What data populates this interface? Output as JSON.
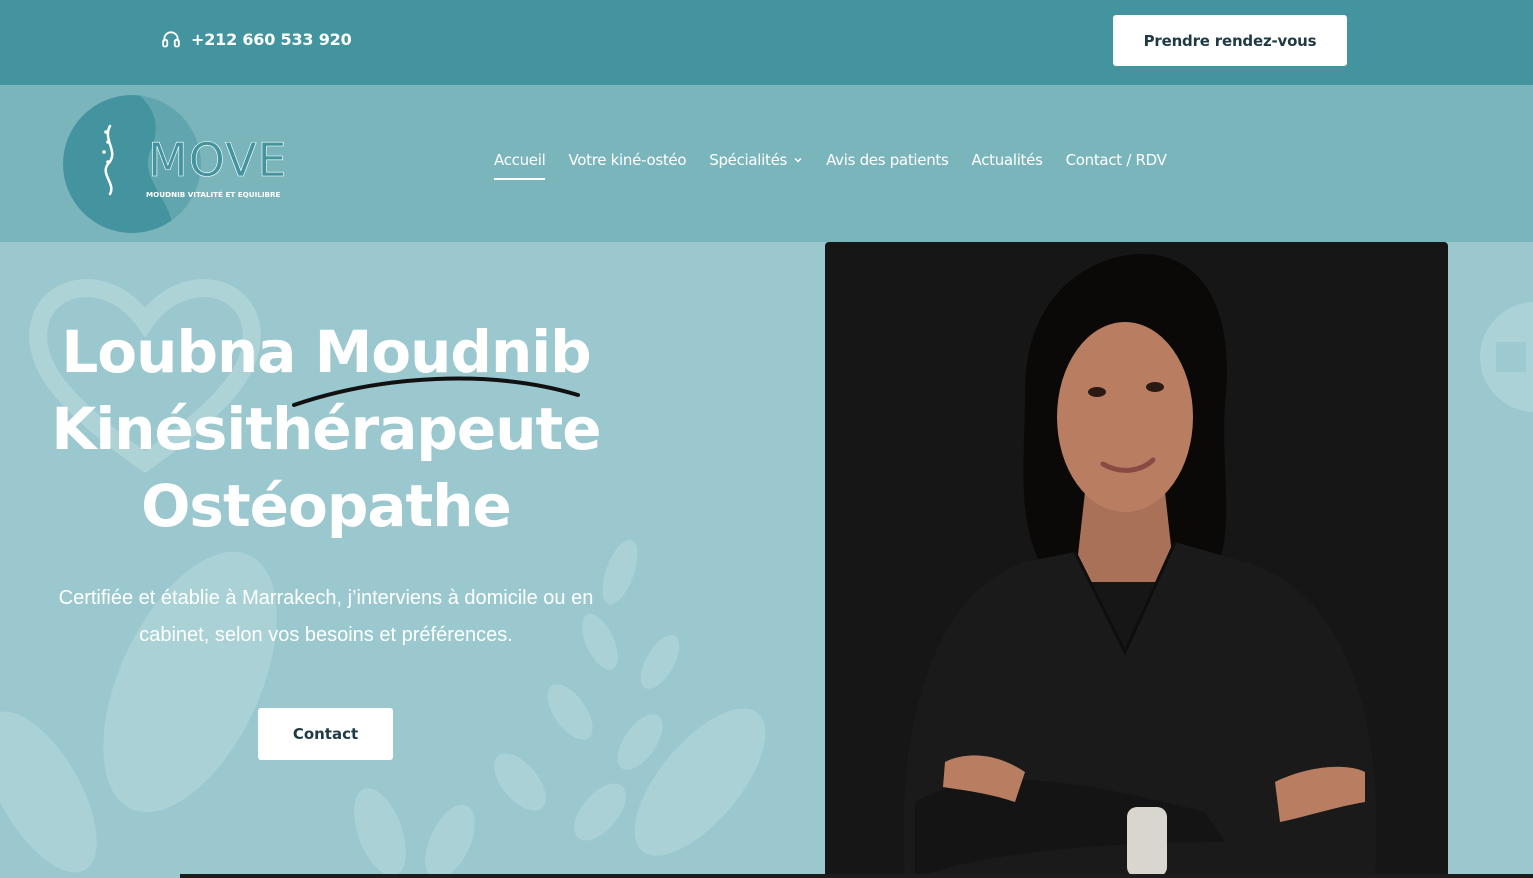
{
  "topbar": {
    "phone": "+212 660 533 920",
    "phone_icon": "headset-icon",
    "cta_label": "Prendre rendez-vous"
  },
  "header": {
    "logo": {
      "brand": "MOVE",
      "tagline": "MOUDNIB VITALITÉ ET EQUILIBRE"
    },
    "nav": [
      {
        "label": "Accueil",
        "active": true
      },
      {
        "label": "Votre kiné-ostéo",
        "active": false
      },
      {
        "label": "Spécialités",
        "active": false,
        "dropdown": true
      },
      {
        "label": "Avis des patients",
        "active": false
      },
      {
        "label": "Actualités",
        "active": false
      },
      {
        "label": "Contact / RDV",
        "active": false
      }
    ]
  },
  "hero": {
    "title_lines": [
      "Loubna Moudnib",
      "Kinésithérapeute",
      "Ostéopathe"
    ],
    "subtitle": "Certifiée et établie à Marrakech, j’interviens à domicile ou en cabinet, selon vos besoins et préférences.",
    "contact_label": "Contact"
  },
  "colors": {
    "topbar": "#43949f",
    "header": "#7ab5bc",
    "hero": "#9ac8ce",
    "button_text": "#1f3a43"
  }
}
